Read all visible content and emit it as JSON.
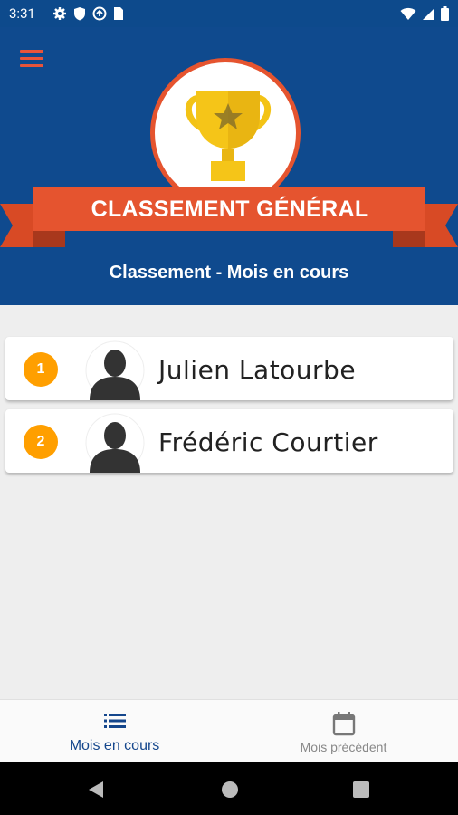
{
  "status_bar": {
    "time": "3:31"
  },
  "header": {
    "banner_title": "CLASSEMENT GÉNÉRAL",
    "subtitle": "Classement - Mois en cours"
  },
  "ranking": [
    {
      "rank": "1",
      "name": "Julien Latourbe"
    },
    {
      "rank": "2",
      "name": "Frédéric Courtier"
    }
  ],
  "bottom_nav": {
    "current_month_label": "Mois en cours",
    "previous_month_label": "Mois précédent"
  },
  "colors": {
    "header_blue": "#0f4a8e",
    "ribbon_orange": "#e5542f",
    "rank_badge": "#ff9f00",
    "nav_active": "#14468c"
  },
  "icons": [
    "menu-icon",
    "trophy-icon",
    "avatar-icon",
    "list-icon",
    "calendar-icon",
    "back-icon",
    "home-icon",
    "recents-icon",
    "wifi-icon",
    "signal-icon",
    "battery-icon",
    "settings-icon",
    "shield-icon",
    "sync-icon",
    "sim-icon"
  ]
}
